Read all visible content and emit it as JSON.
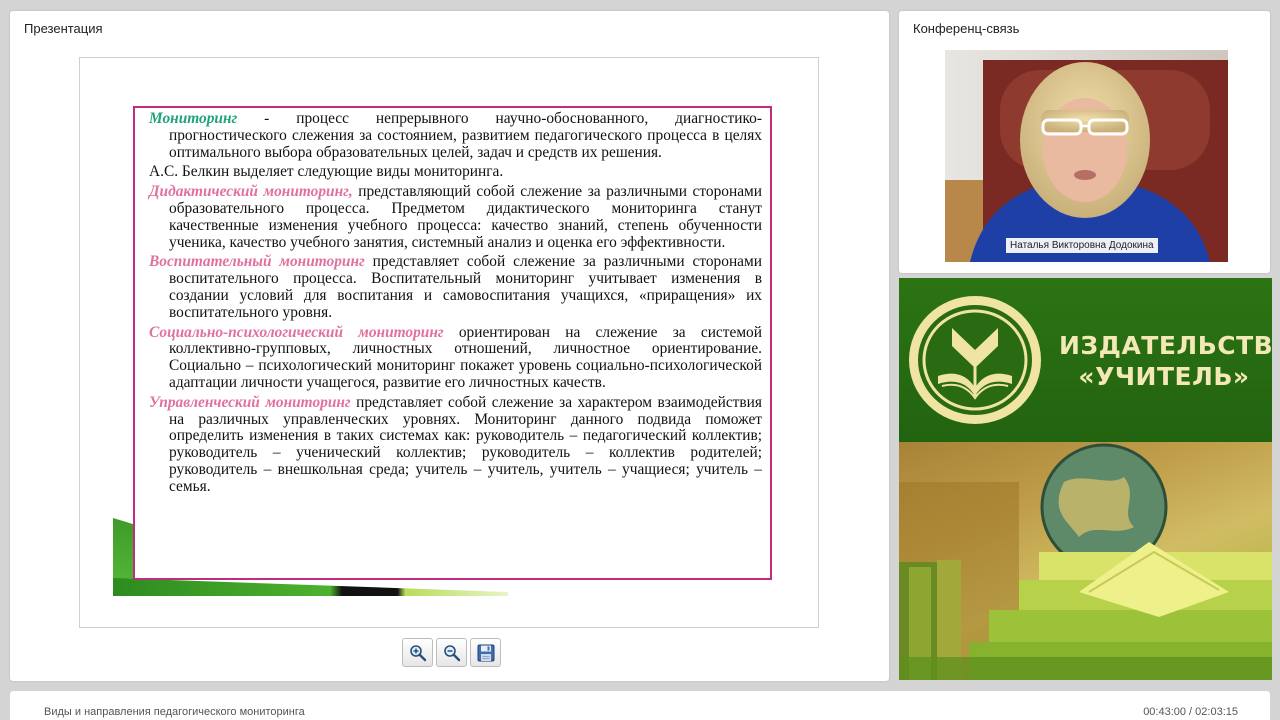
{
  "presentation": {
    "panel_title": "Презентация",
    "slide": {
      "paragraphs": [
        {
          "term": "Мониторинг",
          "text": " - процесс непрерывного научно-обоснованного, диагностико-прогностического слежения за состоянием, развитием педагогического процесса в целях оптимального выбора образовательных целей, задач и средств их решения."
        },
        {
          "term": "",
          "text": "А.С. Белкин выделяет следующие виды мониторинга."
        },
        {
          "term": "Дидактический мониторинг,",
          "text": " представляющий собой слежение за различными сторонами образовательного процесса. Предметом дидактического мониторинга станут качественные изменения учебного процесса: качество знаний, степень обученности ученика, качество учебного занятия, системный анализ и оценка его эффективности."
        },
        {
          "term": "Воспитательный мониторинг",
          "text": " представляет собой слежение за различными сторонами воспитательного процесса. Воспитательный мониторинг учитывает изменения в создании условий для воспитания и самовоспитания учащихся, «приращения» их воспитательного уровня."
        },
        {
          "term": "Социально-психологический мониторинг",
          "text": " ориентирован на слежение за системой коллективно-групповых, личностных отношений, личностное ориентирование. Социально – психологический мониторинг покажет уровень социально-психологической адаптации личности учащегося, развитие его личностных качеств."
        },
        {
          "term": "Управленческий мониторинг",
          "text": " представляет собой слежение за характером взаимодействия на различных управленческих уровнях. Мониторинг данного подвида поможет определить изменения в таких системах как: руководитель – педагогический коллектив; руководитель – ученический коллектив; руководитель – коллектив родителей; руководитель – внешкольная среда; учитель – учитель, учитель – учащиеся; учитель – семья."
        }
      ]
    },
    "toolbar": {
      "zoom_in_icon": "zoom-in-icon",
      "zoom_out_icon": "zoom-out-icon",
      "save_icon": "floppy-disk-icon"
    }
  },
  "conference": {
    "panel_title": "Конференц-связь",
    "speaker_name": "Наталья Викторовна Додокина"
  },
  "ad": {
    "brand_line1": "ИЗДАТЕЛЬСТВО",
    "brand_line2": "«УЧИТЕЛЬ»"
  },
  "status": {
    "lecture_title": "Виды и направления педагогического мониторинга",
    "time": "00:43:00 / 02:03:15"
  },
  "colors": {
    "frame_border": "#c12d7e",
    "term_pink": "#e0709f",
    "term_green": "#1fa37c",
    "brand_green": "#226310",
    "brand_text": "#f4e9b6"
  }
}
